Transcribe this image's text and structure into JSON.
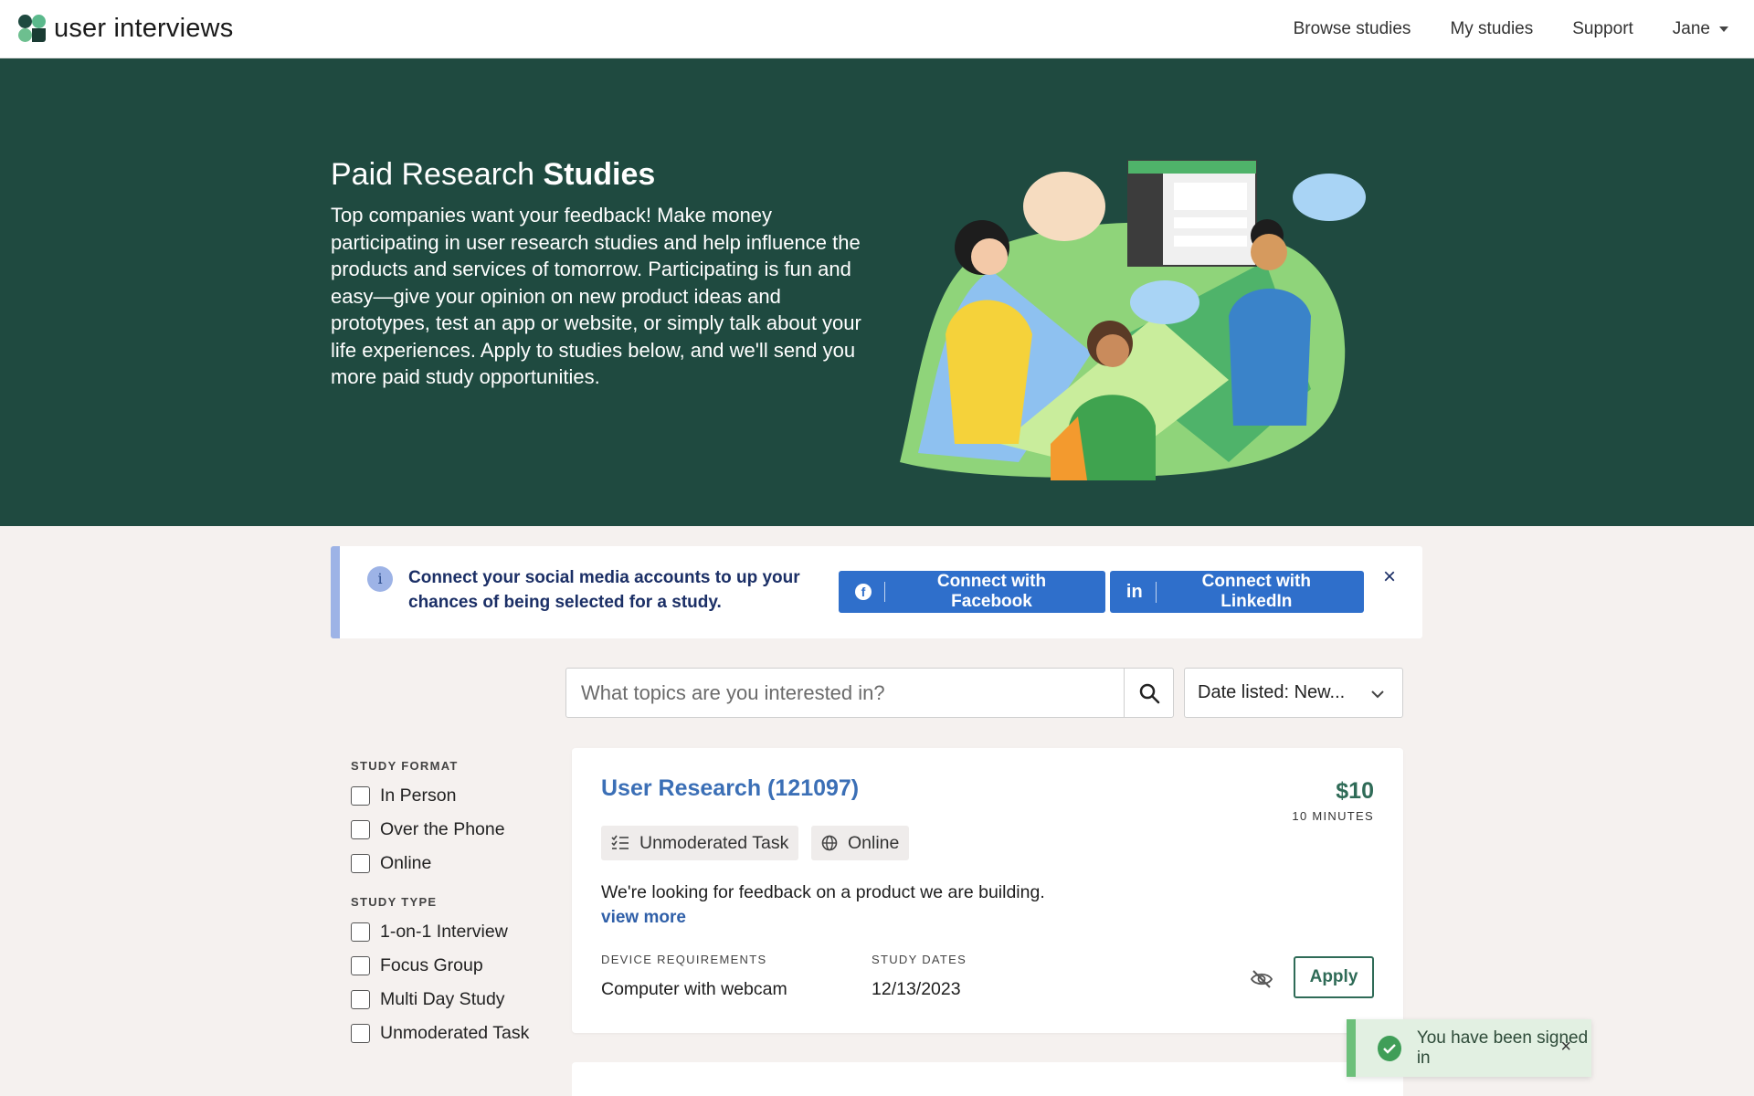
{
  "header": {
    "logo_text": "user interviews",
    "nav": [
      {
        "label": "Browse studies"
      },
      {
        "label": "My studies"
      },
      {
        "label": "Support"
      }
    ],
    "user_name": "Jane"
  },
  "hero": {
    "title_regular": "Paid Research",
    "title_bold": "Studies",
    "body": "Top companies want your feedback! Make money participating in user research studies and help influence the products and services of tomorrow. Participating is fun and easy—give your opinion on new product ideas and prototypes, test an app or website, or simply talk about your life experiences. Apply to studies below, and we'll send you more paid study opportunities."
  },
  "banner": {
    "text": "Connect your social media accounts to up your chances of being selected for a study.",
    "facebook_label": "Connect with Facebook",
    "linkedin_label": "Connect with LinkedIn",
    "close": "×"
  },
  "search": {
    "placeholder": "What topics are you interested in?",
    "sort_value": "Date listed: New..."
  },
  "filters": {
    "format_heading": "STUDY FORMAT",
    "format_options": [
      "In Person",
      "Over the Phone",
      "Online"
    ],
    "type_heading": "STUDY TYPE",
    "type_options": [
      "1-on-1 Interview",
      "Focus Group",
      "Multi Day Study",
      "Unmoderated Task"
    ]
  },
  "study": {
    "title": "User Research (121097)",
    "price": "$10",
    "duration": "10 MINUTES",
    "tags": [
      "Unmoderated Task",
      "Online"
    ],
    "description": "We're looking for feedback on a product we are building.",
    "view_more": "view more",
    "device_label": "DEVICE REQUIREMENTS",
    "device_value": "Computer with webcam",
    "dates_label": "STUDY DATES",
    "dates_value": "12/13/2023",
    "apply_label": "Apply"
  },
  "toast": {
    "message": "You have been signed in",
    "close": "×"
  },
  "colors": {
    "hero_bg": "#1f4a40",
    "accent_green": "#2f6b57",
    "link_blue": "#3b6fb6",
    "social_blue": "#2f6fcb",
    "banner_border": "#9db3e6",
    "toast_green": "#6cc07a"
  }
}
